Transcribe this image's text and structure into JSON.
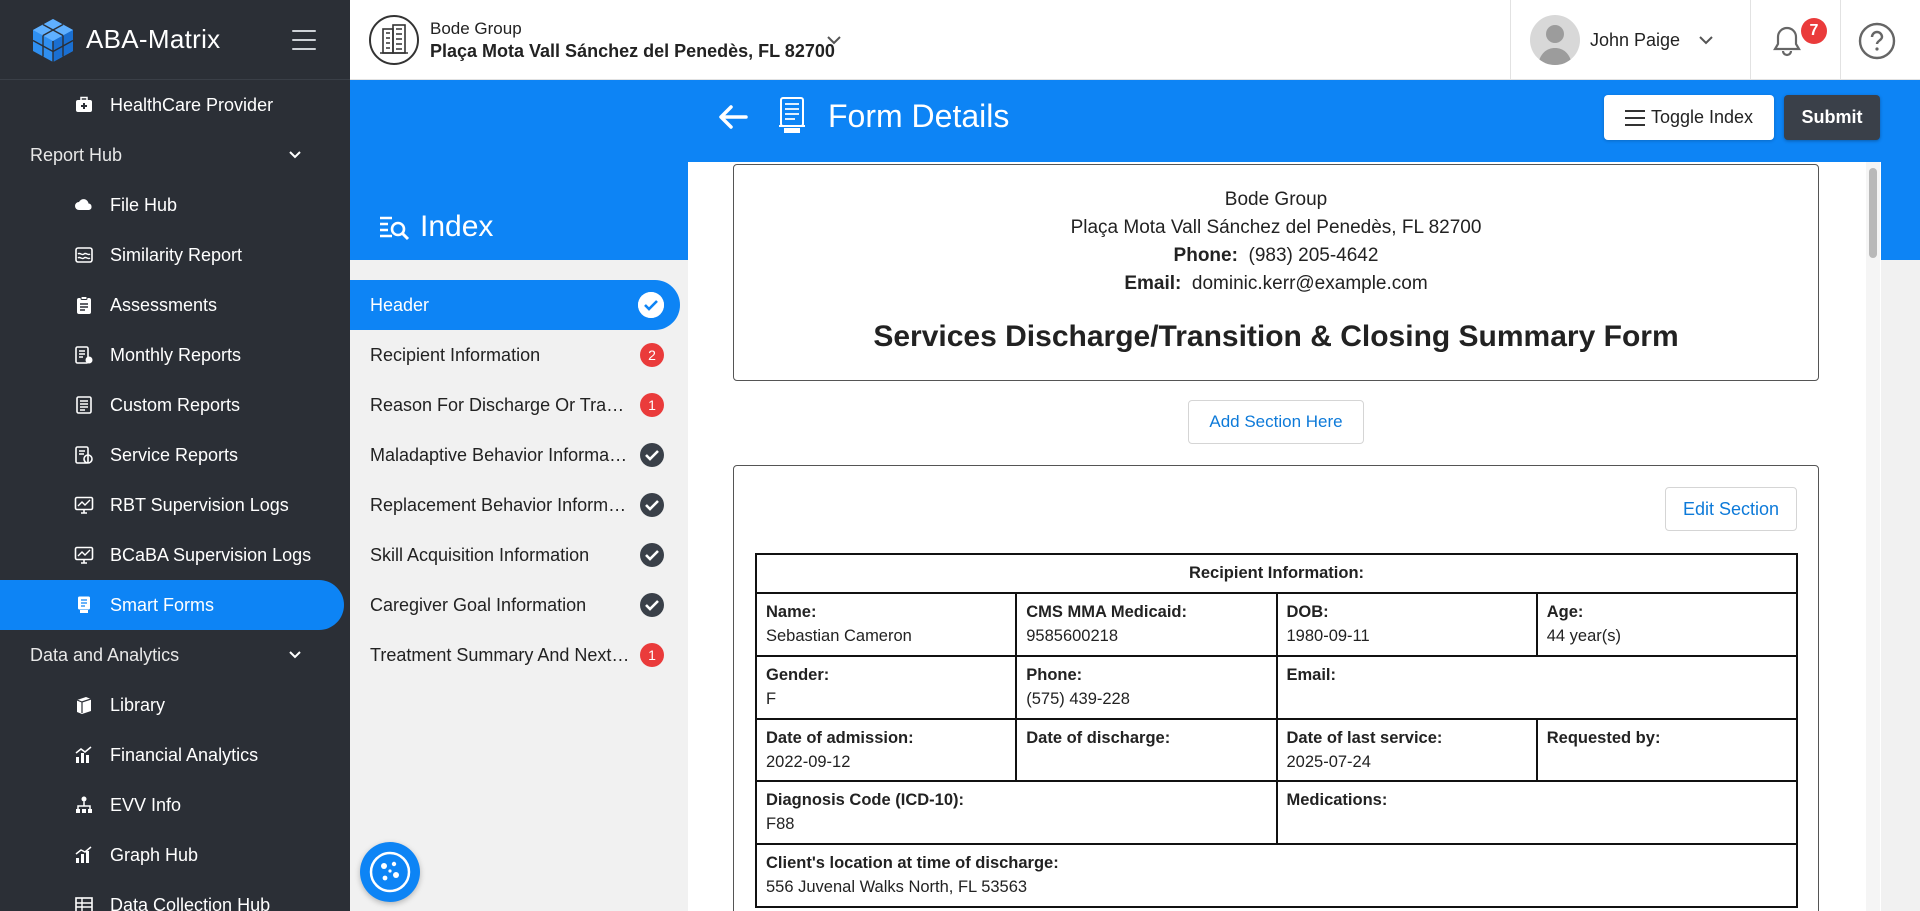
{
  "app": {
    "name": "ABA-Matrix"
  },
  "sidebar": {
    "items": [
      {
        "type": "item",
        "label": "HealthCare Provider",
        "icon": "medical-kit-icon"
      },
      {
        "type": "group",
        "label": "Report Hub"
      },
      {
        "type": "item",
        "label": "File Hub",
        "icon": "cloud-folder-icon"
      },
      {
        "type": "item",
        "label": "Similarity Report",
        "icon": "wave-report-icon"
      },
      {
        "type": "item",
        "label": "Assessments",
        "icon": "clipboard-icon"
      },
      {
        "type": "item",
        "label": "Monthly Reports",
        "icon": "report-gear-icon"
      },
      {
        "type": "item",
        "label": "Custom Reports",
        "icon": "document-list-icon"
      },
      {
        "type": "item",
        "label": "Service Reports",
        "icon": "service-report-icon"
      },
      {
        "type": "item",
        "label": "RBT Supervision Logs",
        "icon": "monitor-chart-icon"
      },
      {
        "type": "item",
        "label": "BCaBA Supervision Logs",
        "icon": "monitor-chart-icon"
      },
      {
        "type": "item",
        "label": "Smart Forms",
        "icon": "smart-form-icon",
        "active": true
      },
      {
        "type": "group",
        "label": "Data and Analytics"
      },
      {
        "type": "item",
        "label": "Library",
        "icon": "library-icon"
      },
      {
        "type": "item",
        "label": "Financial Analytics",
        "icon": "bar-chart-icon"
      },
      {
        "type": "item",
        "label": "EVV Info",
        "icon": "network-icon"
      },
      {
        "type": "item",
        "label": "Graph Hub",
        "icon": "graph-icon"
      },
      {
        "type": "item",
        "label": "Data Collection Hub",
        "icon": "data-grid-icon"
      }
    ]
  },
  "topbar": {
    "org_name": "Bode Group",
    "org_address": "Plaça Mota Vall Sánchez del Penedès, FL 82700",
    "user_name": "John Paige",
    "notifications_count": "7"
  },
  "header": {
    "title": "Form Details",
    "toggle_index_label": "Toggle Index",
    "submit_label": "Submit"
  },
  "index": {
    "title": "Index",
    "items": [
      {
        "label": "Header",
        "status": "done",
        "active": true
      },
      {
        "label": "Recipient Information",
        "status": "error",
        "count": "2"
      },
      {
        "label": "Reason For Discharge Or Transition",
        "status": "error",
        "count": "1"
      },
      {
        "label": "Maladaptive Behavior Information",
        "status": "done"
      },
      {
        "label": "Replacement Behavior Information",
        "status": "done"
      },
      {
        "label": "Skill Acquisition Information",
        "status": "done"
      },
      {
        "label": "Caregiver Goal Information",
        "status": "done"
      },
      {
        "label": "Treatment Summary And Next Steps",
        "status": "error",
        "count": "1"
      }
    ]
  },
  "form": {
    "org_name": "Bode Group",
    "org_address": "Plaça Mota Vall Sánchez del Penedès, FL 82700",
    "phone_label": "Phone:",
    "phone_value": "(983) 205-4642",
    "email_label": "Email:",
    "email_value": "dominic.kerr@example.com",
    "title": "Services Discharge/Transition & Closing Summary Form",
    "add_section_label": "Add Section Here",
    "edit_section_label": "Edit Section",
    "recipient": {
      "caption": "Recipient Information:",
      "name_label": "Name:",
      "name": "Sebastian Cameron",
      "medicaid_label": "CMS MMA Medicaid:",
      "medicaid": "9585600218",
      "dob_label": "DOB:",
      "dob": "1980-09-11",
      "age_label": "Age:",
      "age": "44 year(s)",
      "gender_label": "Gender:",
      "gender": "F",
      "phone_label": "Phone:",
      "phone": "(575) 439-228",
      "email_label": "Email:",
      "email": "",
      "admission_label": "Date of admission:",
      "admission": "2022-09-12",
      "discharge_label": "Date of discharge:",
      "discharge": "",
      "last_service_label": "Date of last service:",
      "last_service": "2025-07-24",
      "requested_by_label": "Requested by:",
      "requested_by": "",
      "diagnosis_label": "Diagnosis Code (ICD-10):",
      "diagnosis": "F88",
      "medications_label": "Medications:",
      "medications": "",
      "location_label": "Client's location at time of discharge:",
      "location": "556 Juvenal Walks North, FL 53563"
    }
  },
  "colors": {
    "primary": "#0d84f5",
    "sidebar": "#2b2f36",
    "badge_error": "#ea3b3b",
    "badge_done": "#3a4049"
  }
}
